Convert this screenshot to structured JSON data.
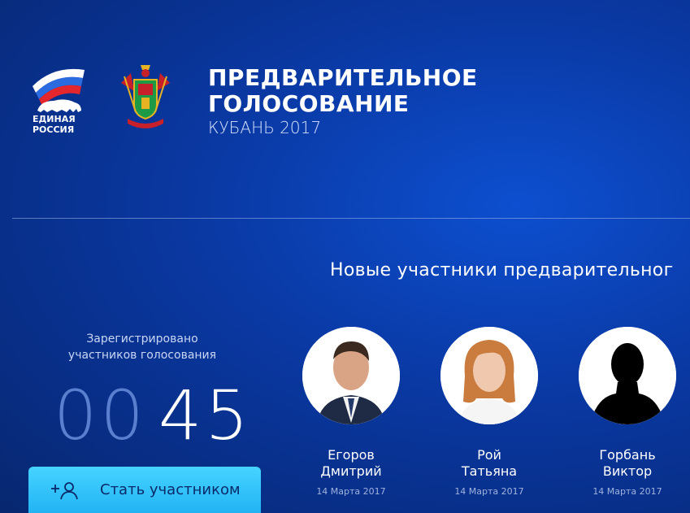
{
  "brand": {
    "party_logo_text_line1": "ЕДИНАЯ",
    "party_logo_text_line2": "РОССИЯ",
    "party_logo_icon": "bear-flag-logo",
    "coat_of_arms_icon": "kuban-coat-of-arms"
  },
  "header": {
    "title_line1": "ПРЕДВАРИТЕЛЬНОЕ",
    "title_line2": "ГОЛОСОВАНИЕ",
    "subtitle": "КУБАНЬ 2017"
  },
  "participants_section": {
    "title": "Новые участники предварительног"
  },
  "registration": {
    "label_line1": "Зарегистрировано",
    "label_line2": "участников голосования",
    "counter_zeros": "00",
    "counter_value": "45"
  },
  "cta": {
    "label": "Стать участником",
    "icon": "add-user-icon"
  },
  "participants": [
    {
      "last_name": "Егоров",
      "first_name": "Дмитрий",
      "date": "14 Марта 2017"
    },
    {
      "last_name": "Рой",
      "first_name": "Татьяна",
      "date": "14 Марта 2017"
    },
    {
      "last_name": "Горбань",
      "first_name": "Виктор",
      "date": "14 Марта 2017"
    }
  ],
  "colors": {
    "background": "#0a3aa6",
    "cta": "#2fc0f8",
    "counter_dim": "#5a7fcf"
  }
}
